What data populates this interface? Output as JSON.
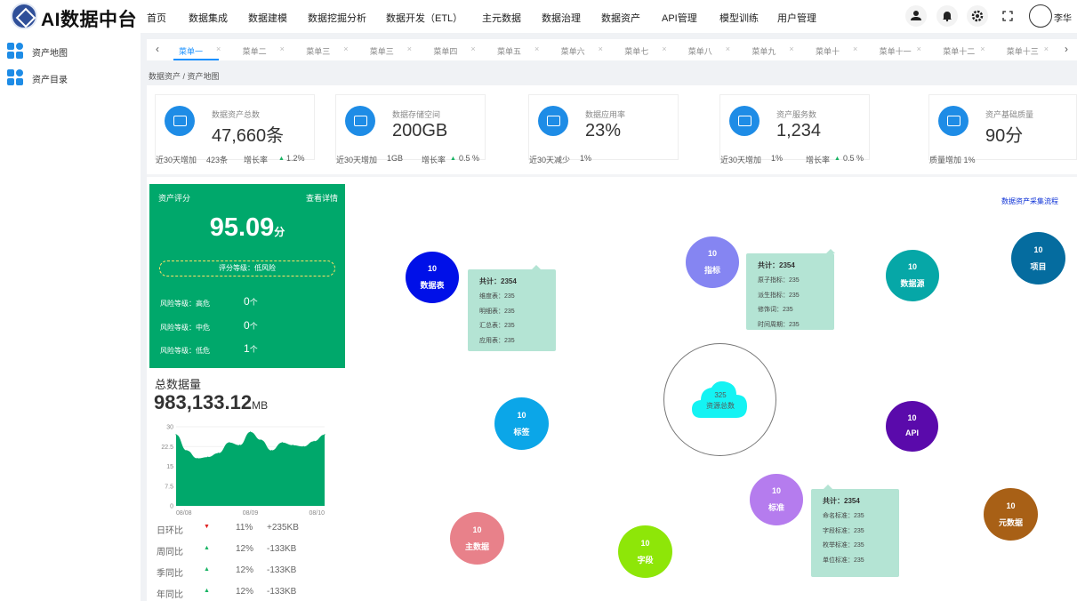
{
  "header": {
    "logo": "AI数据中台",
    "nav": [
      "首页",
      "数据集成",
      "数据建模",
      "数据挖掘分析",
      "数据开发（ETL）",
      "主元数据",
      "数据治理",
      "数据资产",
      "API管理",
      "模型训练",
      "用户管理"
    ],
    "user_name": "李华",
    "icons": [
      "user-icon",
      "bell-icon",
      "gear-icon",
      "fullscreen-icon"
    ]
  },
  "sidebar": {
    "items": [
      {
        "label": "资产地图",
        "icon": "grid-icon"
      },
      {
        "label": "资产目录",
        "icon": "grid-icon"
      }
    ]
  },
  "tabs": {
    "prev": "‹",
    "next": "›",
    "close": "×",
    "items": [
      "菜单一",
      "菜单二",
      "菜单三",
      "菜单三",
      "菜单四",
      "菜单五",
      "菜单六",
      "菜单七",
      "菜单八",
      "菜单九",
      "菜单十",
      "菜单十一",
      "菜单十二",
      "菜单十三"
    ],
    "active_index": 0
  },
  "breadcrumb": "数据资产 / 资产地图",
  "kpis": [
    {
      "label": "数据资产总数",
      "value": "47,660条",
      "foot": [
        {
          "t": "近30天增加"
        },
        {
          "t": "423条"
        },
        {
          "t": "增长率"
        },
        {
          "t": "▲",
          "g": true
        },
        {
          "t": "1.2%"
        }
      ]
    },
    {
      "label": "数据存储空间",
      "value": "200GB",
      "foot": [
        {
          "t": "近30天增加"
        },
        {
          "t": "1GB"
        },
        {
          "t": "增长率"
        },
        {
          "t": "▲",
          "g": true
        },
        {
          "t": "0.5 %"
        }
      ]
    },
    {
      "label": "数据应用率",
      "value": "23%",
      "foot": [
        {
          "t": "近30天减少"
        },
        {
          "t": "1%"
        }
      ]
    },
    {
      "label": "资产服务数",
      "value": "1,234",
      "foot": [
        {
          "t": "近30天增加"
        },
        {
          "t": "1%"
        },
        {
          "t": "增长率"
        },
        {
          "t": "▲",
          "g": true
        },
        {
          "t": "0.5 %"
        }
      ]
    },
    {
      "label": "资产基础质量",
      "value": "90分",
      "foot": [
        {
          "t": "质量增加 1%"
        }
      ]
    }
  ],
  "score": {
    "title": "资产评分",
    "detail": "查看详情",
    "value": "95.09",
    "unit": "分",
    "grade": "评分等级：低风险",
    "risks": [
      {
        "label": "风险等级：高危",
        "count": "0",
        "unit": "个"
      },
      {
        "label": "风险等级：中危",
        "count": "0",
        "unit": "个"
      },
      {
        "label": "风险等级：低危",
        "count": "1",
        "unit": "个"
      }
    ]
  },
  "total": {
    "title": "总数据量",
    "value": "983,133.12",
    "unit": "MB"
  },
  "chart_data": {
    "type": "area",
    "x": [
      "08/08",
      "08/09",
      "08/10"
    ],
    "y_ticks": [
      "30",
      "22.5",
      "15",
      "7.5",
      "0"
    ],
    "ylim": [
      0,
      30
    ],
    "series": [
      {
        "values": [
          27,
          21,
          18,
          18.5,
          20,
          24,
          23,
          28,
          25,
          21,
          24,
          23,
          22.5,
          24.5,
          27
        ]
      }
    ],
    "color": "#00a86b"
  },
  "compare": [
    {
      "label": "日环比",
      "arrow": "▼",
      "color": "#e02020",
      "pct": "11%",
      "delta": "+235KB"
    },
    {
      "label": "周同比",
      "arrow": "▲",
      "color": "#19b464",
      "pct": "12%",
      "delta": "-133KB"
    },
    {
      "label": "季同比",
      "arrow": "▲",
      "color": "#19b464",
      "pct": "12%",
      "delta": "-133KB"
    },
    {
      "label": "年同比",
      "arrow": "▲",
      "color": "#19b464",
      "pct": "12%",
      "delta": "-133KB"
    }
  ],
  "graph": {
    "flow_link": "数据资产采集流程",
    "center": {
      "value": "325",
      "label": "资源总数"
    },
    "nodes": [
      {
        "id": "table",
        "count": "10",
        "label": "数据表",
        "color": "#0010e8"
      },
      {
        "id": "metric",
        "count": "10",
        "label": "指标",
        "color": "#8585f2"
      },
      {
        "id": "datasource",
        "count": "10",
        "label": "数据源",
        "color": "#06a7a7"
      },
      {
        "id": "project",
        "count": "10",
        "label": "项目",
        "color": "#056c9f"
      },
      {
        "id": "tag",
        "count": "10",
        "label": "标签",
        "color": "#0ba6e8"
      },
      {
        "id": "api",
        "count": "10",
        "label": "API",
        "color": "#5a0aab"
      },
      {
        "id": "standard",
        "count": "10",
        "label": "标准",
        "color": "#b57cee"
      },
      {
        "id": "metadata",
        "count": "10",
        "label": "元数据",
        "color": "#a86016"
      },
      {
        "id": "masterdata",
        "count": "10",
        "label": "主数据",
        "color": "#e8818a"
      },
      {
        "id": "field",
        "count": "10",
        "label": "字段",
        "color": "#8ee608"
      }
    ],
    "tips": [
      {
        "total": "共计：2354",
        "rows": [
          "维度表：235",
          "明细表：235",
          "汇总表：235",
          "应用表：235"
        ]
      },
      {
        "total": "共计：2354",
        "rows": [
          "原子指标：235",
          "派生指标：235",
          "修饰词：235",
          "时间周期：235"
        ]
      },
      {
        "total": "共计：2354",
        "rows": [
          "命名标准：235",
          "字段标准：235",
          "枚举标准：235",
          "单位标准：235"
        ]
      }
    ]
  }
}
